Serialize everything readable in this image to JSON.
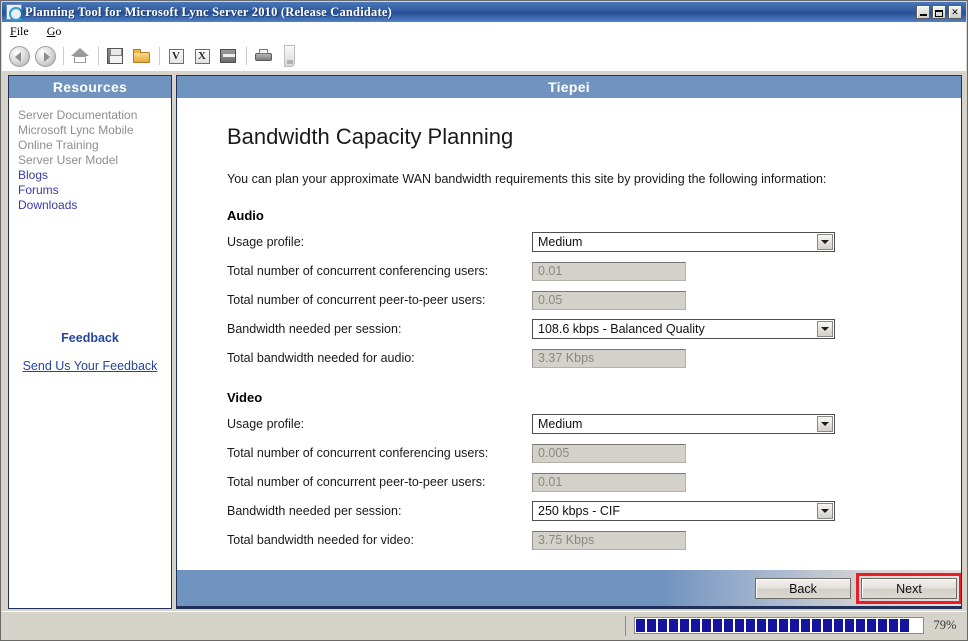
{
  "window": {
    "title": "Planning Tool for Microsoft Lync Server 2010 (Release Candidate)",
    "icon": "lync-app-icon",
    "minimize_label": "_",
    "maximize_label": "□",
    "close_label": "✕"
  },
  "menu": {
    "items": [
      {
        "label": "File",
        "accel": "F"
      },
      {
        "label": "Go",
        "accel": "G"
      }
    ]
  },
  "toolbar": {
    "items": [
      {
        "name": "back-icon",
        "tooltip": "Back"
      },
      {
        "name": "forward-icon",
        "tooltip": "Forward"
      },
      {
        "name": "home-icon",
        "tooltip": "Home"
      },
      {
        "name": "save-icon",
        "tooltip": "Save"
      },
      {
        "name": "open-folder-icon",
        "tooltip": "Open"
      },
      {
        "name": "visio-export-icon",
        "label": "V"
      },
      {
        "name": "excel-export-icon",
        "label": "X"
      },
      {
        "name": "archive-icon",
        "tooltip": "Archive"
      },
      {
        "name": "print-icon",
        "tooltip": "Print"
      },
      {
        "name": "toolbar-grip-icon",
        "tooltip": "Toolbar options"
      }
    ]
  },
  "sidebar": {
    "header": "Resources",
    "items": [
      {
        "label": "Server Documentation",
        "muted": true
      },
      {
        "label": "Microsoft Lync Mobile",
        "muted": true
      },
      {
        "label": "Online Training",
        "muted": true
      },
      {
        "label": "Server User Model",
        "muted": true
      },
      {
        "label": "Blogs",
        "muted": false
      },
      {
        "label": "Forums",
        "muted": false
      },
      {
        "label": "Downloads",
        "muted": false
      }
    ],
    "feedback_title": "Feedback",
    "feedback_link": "Send Us Your Feedback"
  },
  "content": {
    "header": "Tiepei",
    "page_title": "Bandwidth Capacity Planning",
    "intro": "You can plan your approximate WAN bandwidth requirements this site by providing the following information:",
    "sections": [
      {
        "title": "Audio",
        "rows": [
          {
            "label": "Usage profile:",
            "type": "combo",
            "value": "Medium"
          },
          {
            "label": "Total number of concurrent conferencing users:",
            "type": "readonly",
            "value": "0.01"
          },
          {
            "label": "Total number of concurrent peer-to-peer users:",
            "type": "readonly",
            "value": "0.05"
          },
          {
            "label": "Bandwidth needed per session:",
            "type": "combo",
            "value": "108.6 kbps - Balanced Quality"
          },
          {
            "label": "Total bandwidth needed for audio:",
            "type": "readonly",
            "value": "3.37 Kbps"
          }
        ]
      },
      {
        "title": "Video",
        "rows": [
          {
            "label": "Usage profile:",
            "type": "combo",
            "value": "Medium"
          },
          {
            "label": "Total number of concurrent conferencing users:",
            "type": "readonly",
            "value": "0.005"
          },
          {
            "label": "Total number of concurrent peer-to-peer users:",
            "type": "readonly",
            "value": "0.01"
          },
          {
            "label": "Bandwidth needed per session:",
            "type": "combo",
            "value": "250 kbps - CIF"
          },
          {
            "label": "Total bandwidth needed for video:",
            "type": "readonly",
            "value": "3.75 Kbps"
          }
        ]
      }
    ],
    "buttons": {
      "back": "Back",
      "next": "Next"
    },
    "highlight_color": "#ed1c24"
  },
  "statusbar": {
    "progress_percent": 79,
    "progress_label": "79%",
    "progress_chunks": 25,
    "progress_total_chunks": 26,
    "progress_color": "#14149e"
  }
}
